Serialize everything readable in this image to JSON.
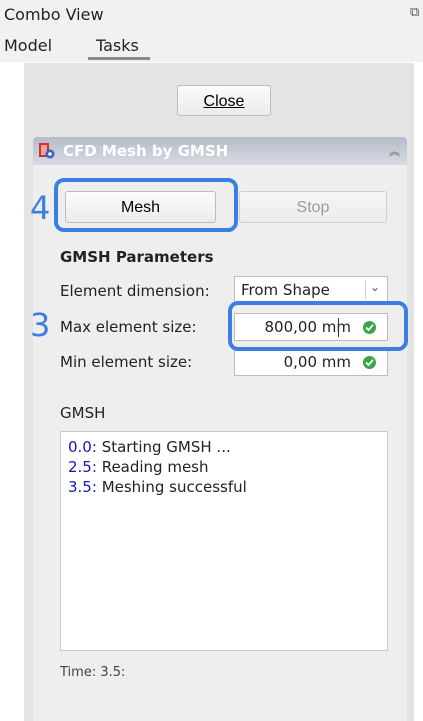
{
  "window": {
    "title": "Combo View",
    "undock_icon": "undock-icon"
  },
  "tabs": [
    {
      "label": "Model",
      "active": false
    },
    {
      "label": "Tasks",
      "active": true
    }
  ],
  "toolbar": {
    "close_label": "Close"
  },
  "taskbox": {
    "title": "CFD Mesh by GMSH",
    "icon": "cfd-mesh-icon",
    "collapse_icon": "collapse-icon"
  },
  "actions": {
    "mesh_label": "Mesh",
    "stop_label": "Stop"
  },
  "parameters": {
    "section_title": "GMSH Parameters",
    "element_dimension": {
      "label": "Element dimension:",
      "value": "From Shape"
    },
    "max_element_size": {
      "label": "Max element size:",
      "value": "800,00 mm"
    },
    "min_element_size": {
      "label": "Min element size:",
      "value": "0,00 mm"
    }
  },
  "console": {
    "label": "GMSH",
    "lines": [
      {
        "time": "0.0:",
        "text": " Starting GMSH ..."
      },
      {
        "time": "2.5:",
        "text": " Reading mesh"
      },
      {
        "time": "3.5:",
        "text": " Meshing successful"
      }
    ]
  },
  "status": {
    "time_text": "Time: 3.5:"
  },
  "annotations": {
    "step_mesh": "4",
    "step_max_size": "3",
    "color": "#3b7fe3"
  }
}
